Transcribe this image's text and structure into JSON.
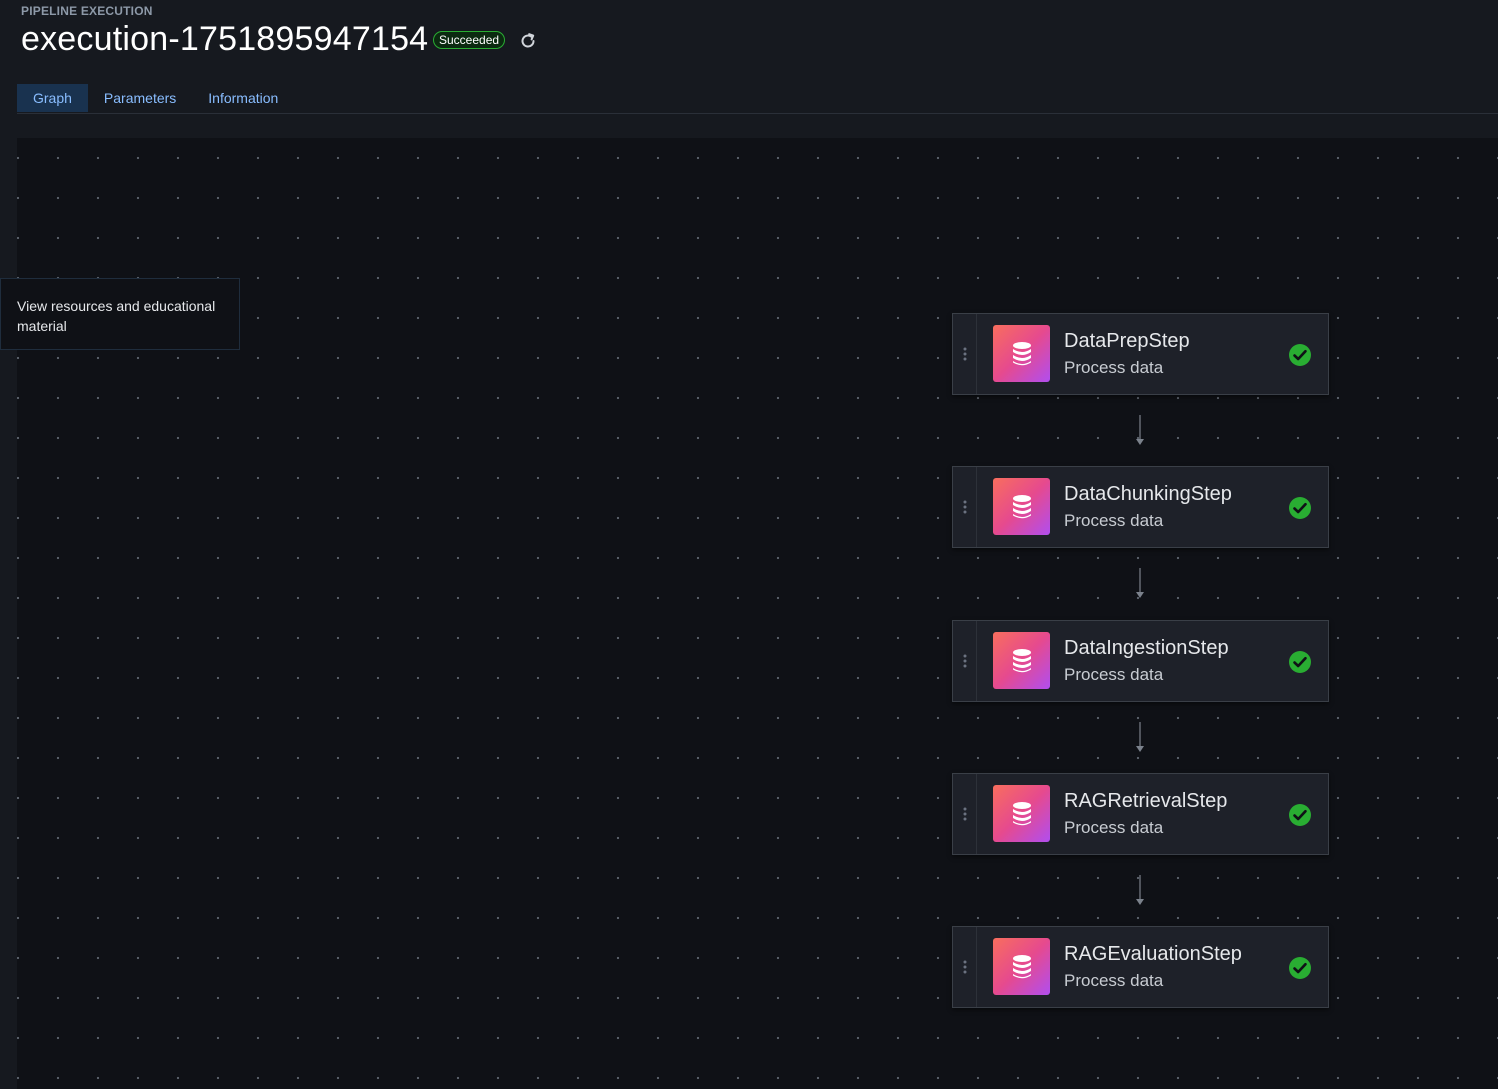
{
  "header": {
    "eyebrow": "PIPELINE EXECUTION",
    "title": "execution-1751895947154",
    "status_badge": "Succeeded",
    "refresh_icon": "refresh-icon"
  },
  "tabs": [
    {
      "label": "Graph",
      "active": true
    },
    {
      "label": "Parameters",
      "active": false
    },
    {
      "label": "Information",
      "active": false
    }
  ],
  "resources_panel": {
    "text": "View resources and educational material"
  },
  "graph": {
    "nodes": [
      {
        "name": "DataPrepStep",
        "type": "Process data",
        "status": "succeeded"
      },
      {
        "name": "DataChunkingStep",
        "type": "Process data",
        "status": "succeeded"
      },
      {
        "name": "DataIngestionStep",
        "type": "Process data",
        "status": "succeeded"
      },
      {
        "name": "RAGRetrievalStep",
        "type": "Process data",
        "status": "succeeded"
      },
      {
        "name": "RAGEvaluationStep",
        "type": "Process data",
        "status": "succeeded"
      }
    ],
    "node_icon": "database-icon",
    "status_icon": "check-circle-icon"
  },
  "colors": {
    "accent": "#89bdff",
    "success": "#29ad32",
    "background": "#0f1116"
  }
}
